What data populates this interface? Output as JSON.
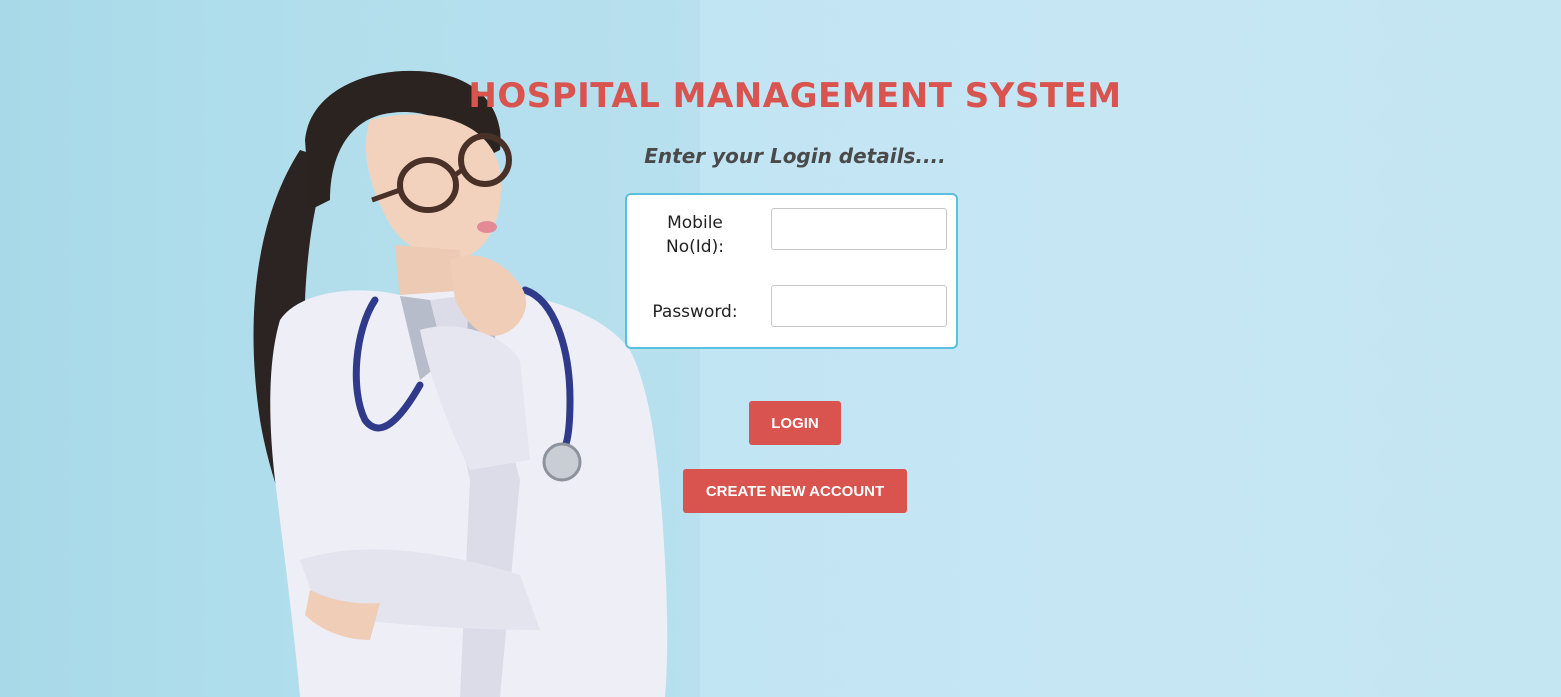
{
  "page": {
    "title": "HOSPITAL MANAGEMENT SYSTEM",
    "subtitle": "Enter your Login details...."
  },
  "login_form": {
    "mobile_label": "Mobile No(Id):",
    "mobile_value": "",
    "password_label": "Password:",
    "password_value": ""
  },
  "buttons": {
    "login_label": "LOGIN",
    "create_account_label": "CREATE NEW ACCOUNT"
  },
  "colors": {
    "accent": "#d9534f",
    "box_border": "#5bc0de",
    "background": "#c2e5f3"
  }
}
